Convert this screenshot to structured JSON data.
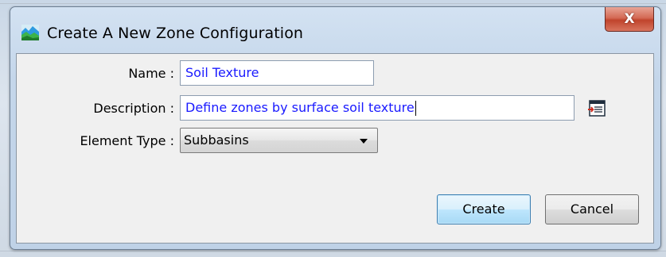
{
  "dialog": {
    "title": "Create A New Zone Configuration",
    "close_label": "X"
  },
  "form": {
    "name_label": "Name :",
    "name_value": "Soil Texture",
    "description_label": "Description :",
    "description_value": "Define zones by surface soil texture",
    "element_type_label": "Element Type :",
    "element_type_value": "Subbasins"
  },
  "buttons": {
    "create": "Create",
    "cancel": "Cancel"
  },
  "icons": {
    "app": "landscape-icon",
    "browse": "text-editor-icon"
  },
  "colors": {
    "input_text": "#1a1aff",
    "default_button_border": "#3c7fb1",
    "close_button": "#c0442c"
  }
}
